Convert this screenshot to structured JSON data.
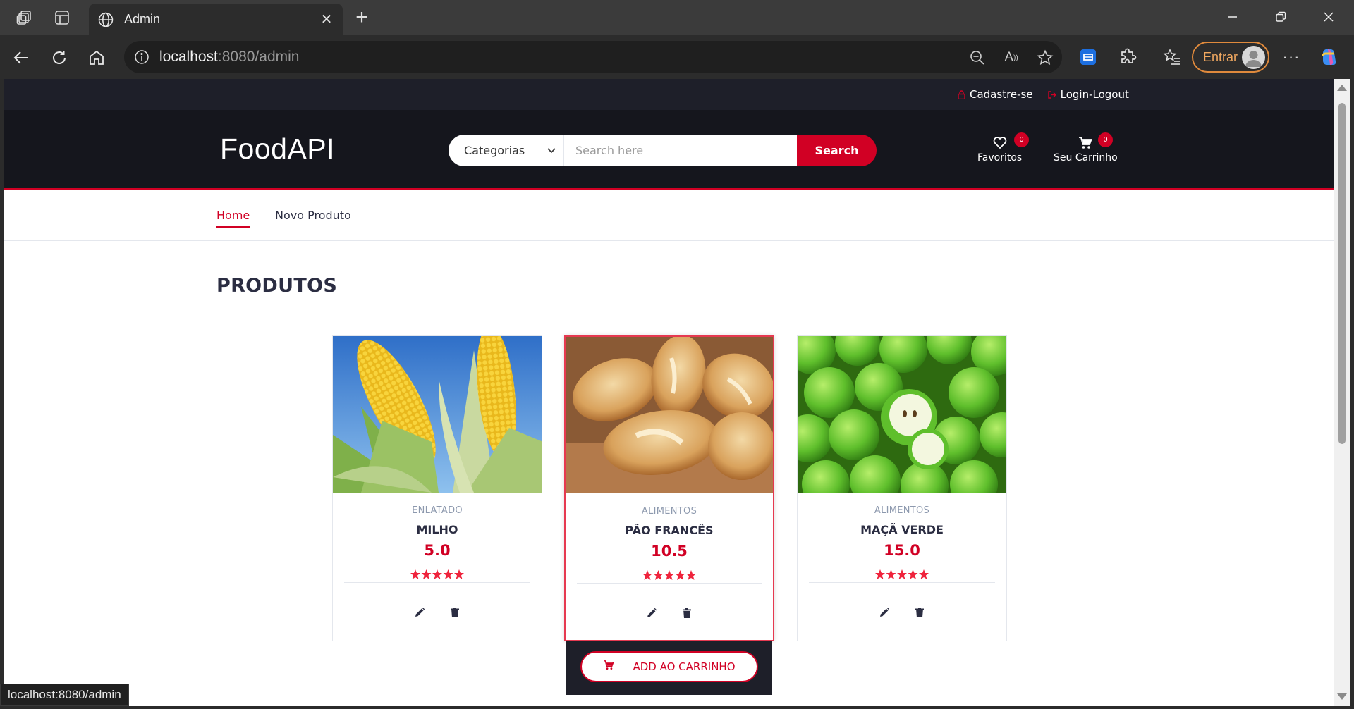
{
  "browser": {
    "tab_title": "Admin",
    "url_host": "localhost",
    "url_rest": ":8080/admin",
    "signin_label": "Entrar",
    "status_url": "localhost:8080/admin"
  },
  "top_header": {
    "register": "Cadastre-se",
    "login": "Login-Logout"
  },
  "header": {
    "logo": "FoodAPI",
    "category_selected": "Categorias",
    "search_placeholder": "Search here",
    "search_label": "Search",
    "favorites_label": "Favoritos",
    "favorites_count": "0",
    "cart_label": "Seu Carrinho",
    "cart_count": "0"
  },
  "nav": {
    "items": [
      {
        "label": "Home",
        "active": true
      },
      {
        "label": "Novo Produto",
        "active": false
      }
    ]
  },
  "section_title": "PRODUTOS",
  "products": [
    {
      "category": "ENLATADO",
      "name": "MILHO",
      "price": "5.0",
      "rating": 5,
      "image": "corn"
    },
    {
      "category": "ALIMENTOS",
      "name": "PÃO FRANCÊS",
      "price": "10.5",
      "rating": 5,
      "image": "bread"
    },
    {
      "category": "ALIMENTOS",
      "name": "MAÇÃ VERDE",
      "price": "15.0",
      "rating": 5,
      "image": "green-apples"
    }
  ],
  "add_to_cart_label": "ADD AO CARRINHO",
  "colors": {
    "accent": "#d10024",
    "header_dark": "#15161d",
    "top_header": "#1e1f29"
  }
}
